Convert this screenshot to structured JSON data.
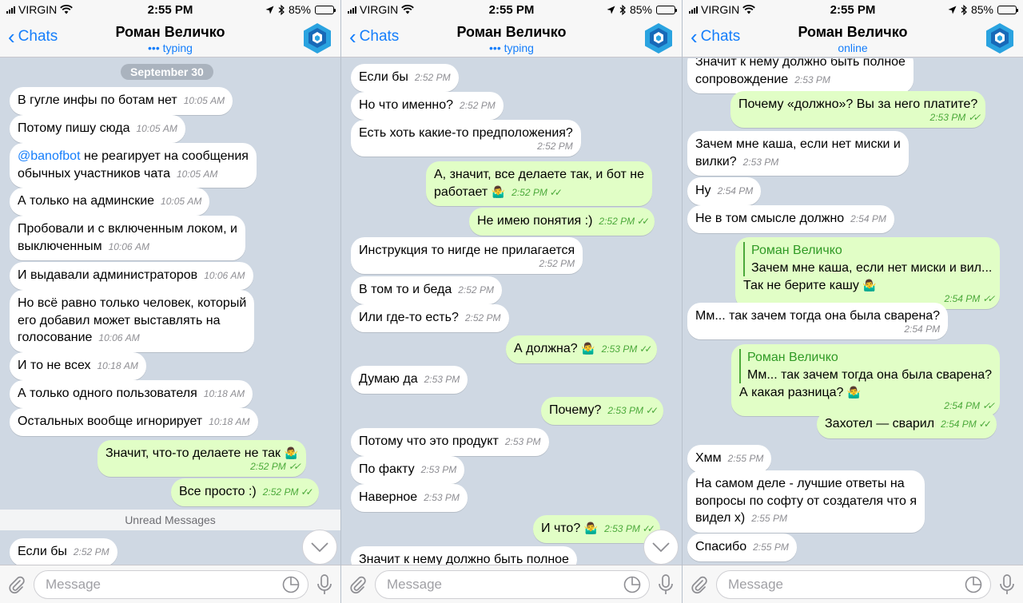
{
  "status_bar": {
    "carrier": "VIRGIN",
    "time": "2:55 PM",
    "battery": "85%",
    "battery_level": 0.85
  },
  "nav": {
    "back_label": "Chats",
    "contact_name": "Роман Величко"
  },
  "input": {
    "placeholder": "Message"
  },
  "colors": {
    "accent": "#157efb",
    "outgoing_bubble": "#e1fec6",
    "incoming_bubble": "#ffffff",
    "chat_bg": "#cfd8e3",
    "read_ticks": "#4ba93a"
  },
  "screens": [
    {
      "contact_status": "••• typing",
      "date_pill": "September 30",
      "unread_label": "Unread Messages",
      "messages": [
        {
          "text": "В гугле инфы по ботам нет",
          "time": "10:05 AM"
        },
        {
          "text": "Потому пишу сюда",
          "time": "10:05 AM"
        },
        {
          "mention": "@banofbot",
          "text": " не реагирует на сообщения",
          "text2": "обычных участников чата",
          "time": "10:05 AM"
        },
        {
          "text": "А только на админские",
          "time": "10:05 AM"
        },
        {
          "text": "Пробовали и с включенным локом, и",
          "text2": "выключенным",
          "time": "10:06 AM"
        },
        {
          "text": "И выдавали администраторов",
          "time": "10:06 AM"
        },
        {
          "text": "Но всё равно только человек, который",
          "text2": "его добавил может выставлять на",
          "text3": "голосование",
          "time": "10:06 AM"
        },
        {
          "text": "И то не всех",
          "time": "10:18 AM"
        },
        {
          "text": "А только одного пользователя",
          "time": "10:18 AM"
        },
        {
          "text": "Остальных вообще игнорирует",
          "time": "10:18 AM"
        },
        {
          "text": "Значит, что-то делаете не так",
          "time": "2:52 PM"
        },
        {
          "text": "Все просто :)",
          "time": "2:52 PM"
        },
        {
          "text": "Если бы",
          "time": "2:52 PM"
        }
      ]
    },
    {
      "contact_status": "••• typing",
      "messages": [
        {
          "text": "Если бы",
          "time": "2:52 PM"
        },
        {
          "text": "Но что именно?",
          "time": "2:52 PM"
        },
        {
          "text": "Есть хоть какие-то предположения?",
          "time": "2:52 PM"
        },
        {
          "text": "А, значит, все делаете так, и бот не",
          "text2": "работает",
          "time": "2:52 PM"
        },
        {
          "text": "Не имею понятия :)",
          "time": "2:52 PM"
        },
        {
          "text": "Инструкция то нигде не прилагается",
          "time": "2:52 PM"
        },
        {
          "text": "В том то и беда",
          "time": "2:52 PM"
        },
        {
          "text": "Или где-то есть?",
          "time": "2:52 PM"
        },
        {
          "text": "А должна?",
          "time": "2:53 PM"
        },
        {
          "text": "Думаю да",
          "time": "2:53 PM"
        },
        {
          "text": "Почему?",
          "time": "2:53 PM"
        },
        {
          "text": "Потому что это продукт",
          "time": "2:53 PM"
        },
        {
          "text": "По факту",
          "time": "2:53 PM"
        },
        {
          "text": "Наверное",
          "time": "2:53 PM"
        },
        {
          "text": "И что?",
          "time": "2:53 PM"
        },
        {
          "text": "Значит к нему должно быть полное"
        }
      ]
    },
    {
      "contact_status": "online",
      "messages": [
        {
          "text": "Значит к нему должно быть полное",
          "text2": "сопровождение",
          "time": "2:53 PM"
        },
        {
          "text": "Почему «должно»? Вы за него платите?",
          "time": "2:53 PM"
        },
        {
          "text": "Зачем мне каша, если нет миски и",
          "text2": "вилки?",
          "time": "2:53 PM"
        },
        {
          "text": "Ну",
          "time": "2:54 PM"
        },
        {
          "text": "Не в том смысле должно",
          "time": "2:54 PM"
        },
        {
          "quote_name": "Роман Величко",
          "quote_text": "Зачем мне каша, если нет миски и вил...",
          "text": "Так не берите кашу",
          "time": "2:54 PM"
        },
        {
          "text": "Мм... так зачем тогда она была сварена?",
          "time": "2:54 PM"
        },
        {
          "quote_name": "Роман Величко",
          "quote_text": "Мм... так зачем тогда она была сварена?",
          "text": "А какая разница?",
          "time": "2:54 PM"
        },
        {
          "text": "Захотел — сварил",
          "time": "2:54 PM"
        },
        {
          "text": "Хмм",
          "time": "2:55 PM"
        },
        {
          "text": "На самом деле - лучшие ответы на",
          "text2": "вопросы по софту от создателя что я",
          "text3": "видел х)",
          "time": "2:55 PM"
        },
        {
          "text": "Спасибо",
          "time": "2:55 PM"
        }
      ]
    }
  ]
}
